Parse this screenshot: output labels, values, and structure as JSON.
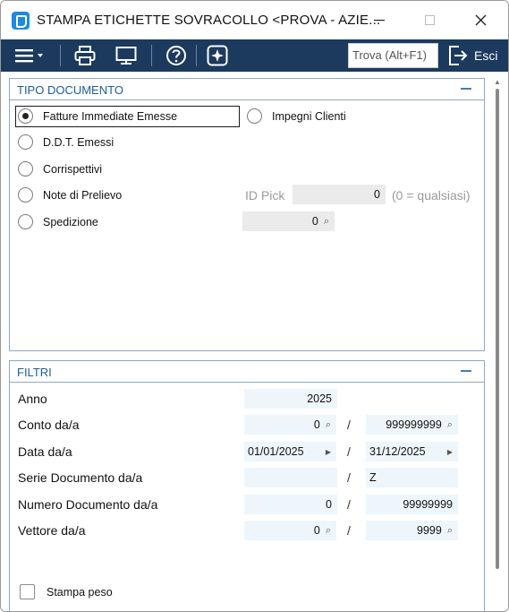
{
  "window": {
    "title": "STAMPA ETICHETTE SOVRACOLLO <PROVA - AZIE...",
    "minimize_icon": "minimize-icon",
    "maximize_icon": "maximize-icon",
    "close_icon": "close-icon"
  },
  "toolbar": {
    "search_placeholder": "Trova (Alt+F1)",
    "exit_label": "Esci"
  },
  "tipo_documento": {
    "title": "TIPO DOCUMENTO",
    "options": [
      {
        "label": "Fatture Immediate Emesse",
        "selected": true
      },
      {
        "label": "Impegni Clienti",
        "selected": false
      },
      {
        "label": "D.D.T. Emessi",
        "selected": false
      },
      {
        "label": "Corrispettivi",
        "selected": false
      },
      {
        "label": "Note di Prelievo",
        "selected": false
      },
      {
        "label": "Spedizione",
        "selected": false
      }
    ],
    "id_pick_label": "ID Pick",
    "id_pick_value": "0",
    "id_pick_hint": "(0 = qualsiasi)",
    "spedizione_value": "0"
  },
  "filtri": {
    "title": "FILTRI",
    "anno": {
      "label": "Anno",
      "value": "2025"
    },
    "conto": {
      "label": "Conto da/a",
      "from": "0",
      "to": "999999999"
    },
    "data": {
      "label": "Data da/a",
      "from": "01/01/2025",
      "to": "31/12/2025"
    },
    "serie": {
      "label": "Serie Documento da/a",
      "from": "",
      "to": "Z"
    },
    "numero": {
      "label": "Numero Documento da/a",
      "from": "0",
      "to": "99999999"
    },
    "vettore": {
      "label": "Vettore da/a",
      "from": "0",
      "to": "9999"
    },
    "separator": "/",
    "stampa_peso": {
      "label": "Stampa peso",
      "checked": false
    }
  },
  "colors": {
    "toolbar_bg": "#1b3a5e",
    "panel_title": "#1d5c96",
    "field_bg": "#eef6fc"
  }
}
